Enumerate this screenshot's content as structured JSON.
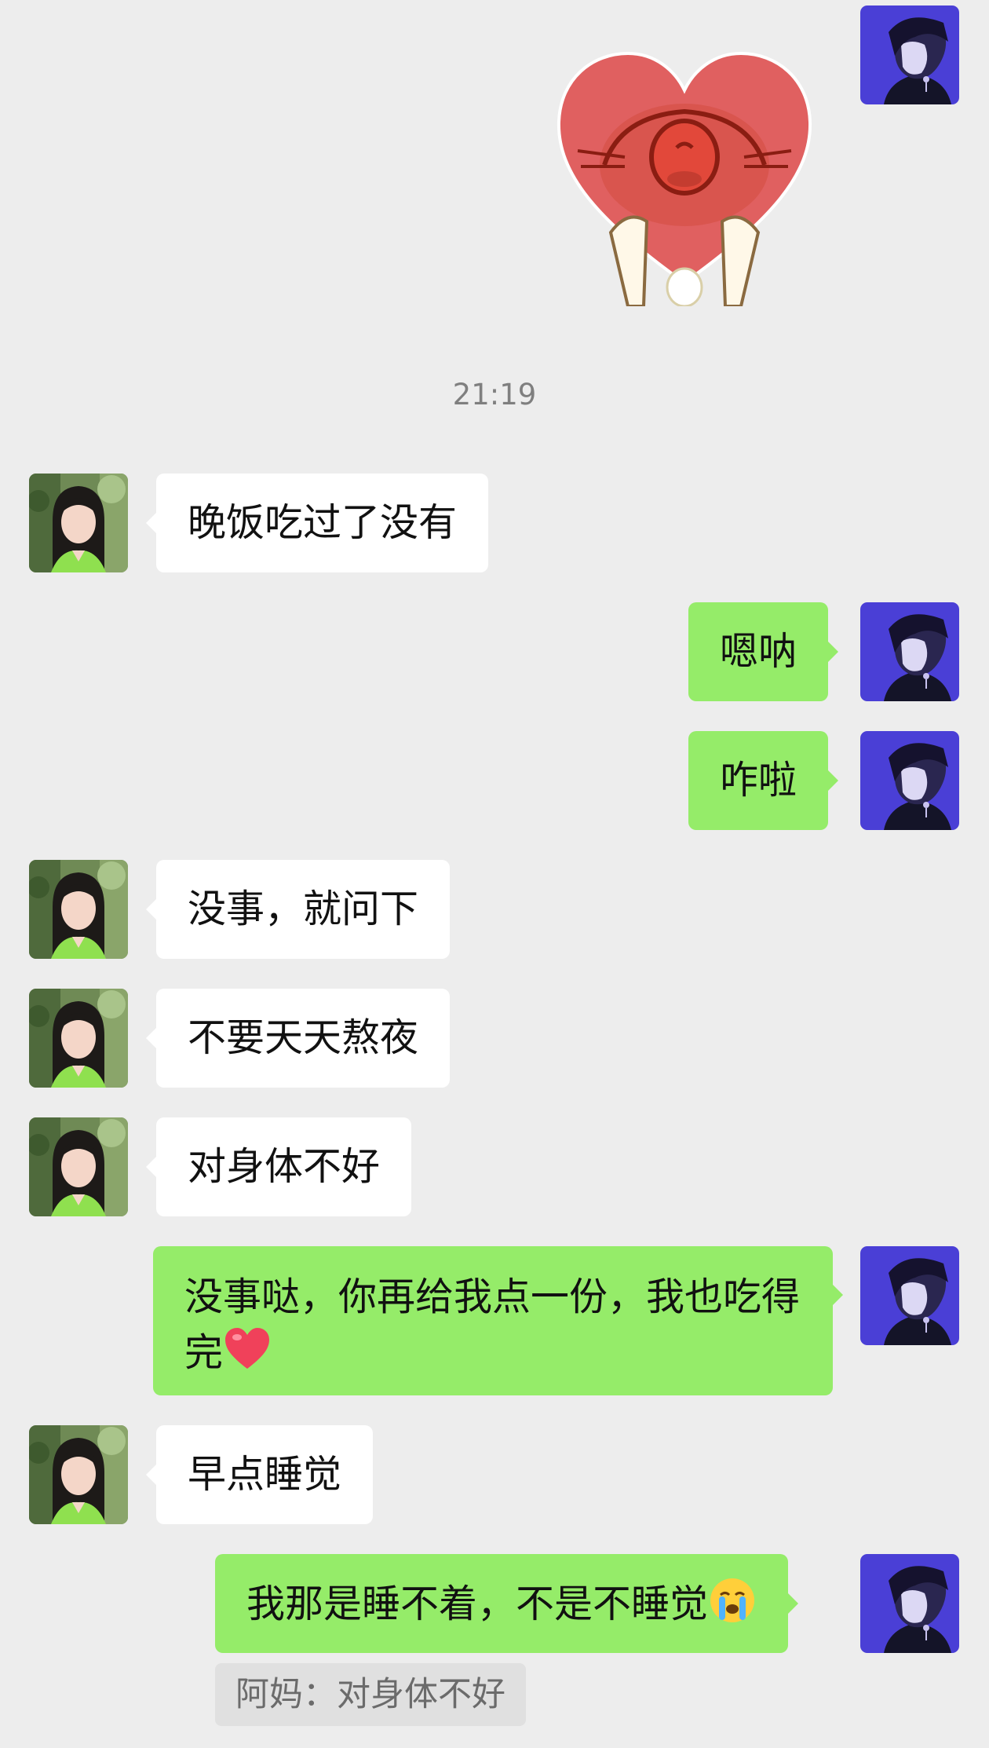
{
  "colors": {
    "background": "#ededed",
    "incoming_bubble": "#ffffff",
    "outgoing_bubble": "#95ec69",
    "quote_bg": "#e0e0e0"
  },
  "timestamp": "21:19",
  "messages": [
    {
      "side": "outgoing",
      "type": "sticker",
      "sticker_icon": "heart-cat-sticker"
    },
    {
      "side": "incoming",
      "text": "晚饭吃过了没有"
    },
    {
      "side": "outgoing",
      "text": "嗯呐"
    },
    {
      "side": "outgoing",
      "text": "咋啦"
    },
    {
      "side": "incoming",
      "text": "没事，就问下"
    },
    {
      "side": "incoming",
      "text": "不要天天熬夜"
    },
    {
      "side": "incoming",
      "text": "对身体不好"
    },
    {
      "side": "outgoing",
      "text": "没事哒，你再给我点一份，我也吃得完",
      "emoji": "red-heart-emoji"
    },
    {
      "side": "incoming",
      "text": "早点睡觉"
    },
    {
      "side": "outgoing",
      "text": "我那是睡不着，不是不睡觉",
      "emoji": "crying-face-emoji"
    }
  ],
  "quote": {
    "text": "阿妈：对身体不好"
  }
}
